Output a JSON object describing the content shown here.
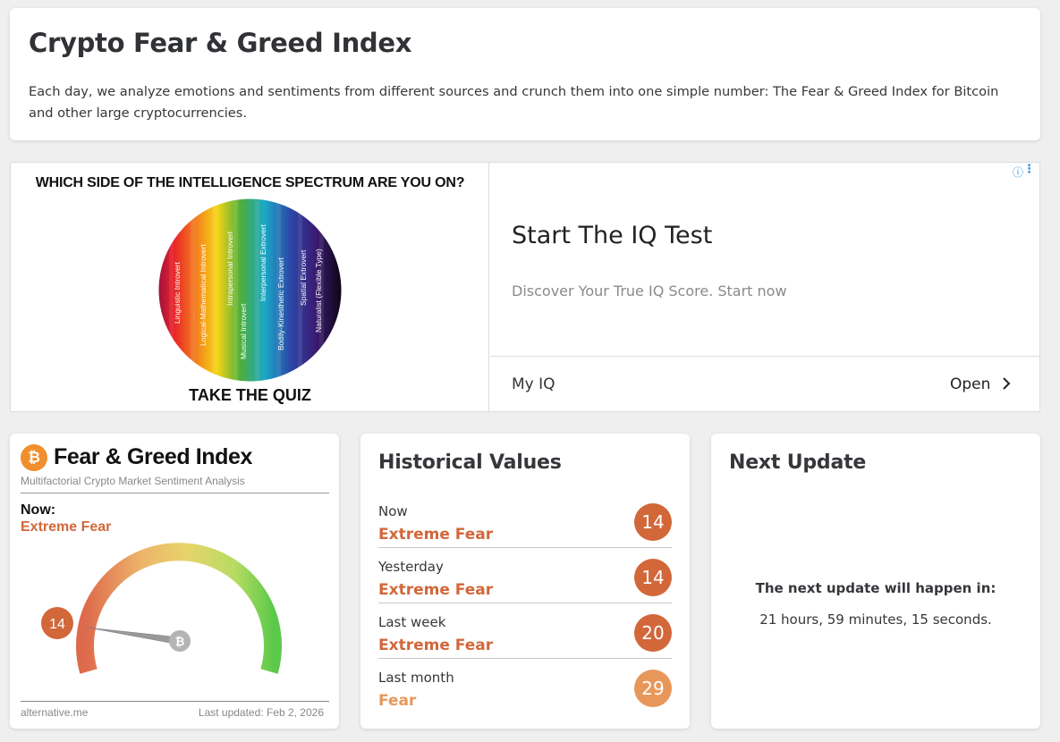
{
  "header": {
    "title": "Crypto Fear & Greed Index",
    "description": "Each day, we analyze emotions and sentiments from different sources and crunch them into one simple number: The Fear & Greed Index for Bitcoin and other large cryptocurrencies."
  },
  "ad": {
    "question": "WHICH SIDE OF THE INTELLIGENCE SPECTRUM ARE YOU ON?",
    "spectrum_labels": [
      "Linguistic Introvert",
      "Logical-Mathematical Introvert",
      "Intrapersonal Introvert",
      "Musical Introvert",
      "Interpersonal Extrovert",
      "Bodily-Kinesthetic Extrovert",
      "Spatial Extrovert",
      "Naturalist (Flexible Type)"
    ],
    "cta_image": "TAKE THE QUIZ",
    "title": "Start The IQ Test",
    "subtitle": "Discover Your True IQ Score. Start now",
    "brand": "My IQ",
    "open_label": "Open",
    "open_icon": "chevron-right-icon",
    "info_icon": "info-icon",
    "more_icon": "more-vertical-icon"
  },
  "index_card": {
    "logo_icon": "bitcoin-icon",
    "logo_glyph": "₿",
    "title": "Fear & Greed Index",
    "subtitle": "Multifactorial Crypto Market Sentiment Analysis",
    "now_label": "Now:",
    "classification": "Extreme Fear",
    "value": "14",
    "value_numeric": 14,
    "scale_max": 100,
    "site": "alternative.me",
    "last_updated": "Last updated: Feb 2, 2026"
  },
  "historical": {
    "title": "Historical Values",
    "rows": [
      {
        "label": "Now",
        "classification": "Extreme Fear",
        "value": "14",
        "color": "#d2673a"
      },
      {
        "label": "Yesterday",
        "classification": "Extreme Fear",
        "value": "14",
        "color": "#d2673a"
      },
      {
        "label": "Last week",
        "classification": "Extreme Fear",
        "value": "20",
        "color": "#d2673a"
      },
      {
        "label": "Last month",
        "classification": "Fear",
        "value": "29",
        "color": "#e8975a"
      }
    ]
  },
  "next_update": {
    "title": "Next Update",
    "label": "The next update will happen in:",
    "value": "21 hours, 59 minutes, 15 seconds."
  },
  "colors": {
    "extreme_fear": "#d2673a",
    "fear": "#e8975a",
    "bitcoin": "#f08f2e"
  }
}
